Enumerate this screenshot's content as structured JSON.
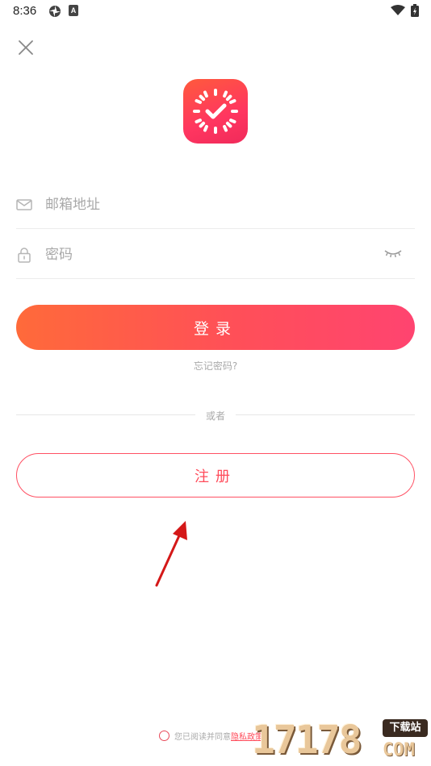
{
  "status_bar": {
    "time": "8:36",
    "notification_icons": [
      "pinwheel-icon",
      "a-badge-icon"
    ],
    "notification_badge_letter": "A",
    "right_icons": [
      "wifi-icon",
      "battery-charging-icon"
    ]
  },
  "header": {
    "close_icon": "close-icon"
  },
  "app": {
    "logo_icon": "clock-check-icon",
    "logo_colors": [
      "#ff5a3c",
      "#f02a5a"
    ]
  },
  "form": {
    "email": {
      "icon": "mail-icon",
      "placeholder": "邮箱地址",
      "value": ""
    },
    "password": {
      "icon": "lock-icon",
      "placeholder": "密码",
      "value": "",
      "toggle_icon": "eye-closed-icon"
    },
    "login_label": "登录",
    "forgot_label": "忘记密码?",
    "or_label": "或者",
    "register_label": "注册"
  },
  "agreement": {
    "text": "您已阅读并同意",
    "link": "隐私政策",
    "checked": false
  },
  "watermark": {
    "digits": "17178",
    "badge": "下载站",
    "suffix": "COM"
  },
  "colors": {
    "accent": "#ff4b5a",
    "gradient_start": "#ff6a3a",
    "gradient_end": "#ff4470",
    "annotation_arrow": "#d41818"
  }
}
